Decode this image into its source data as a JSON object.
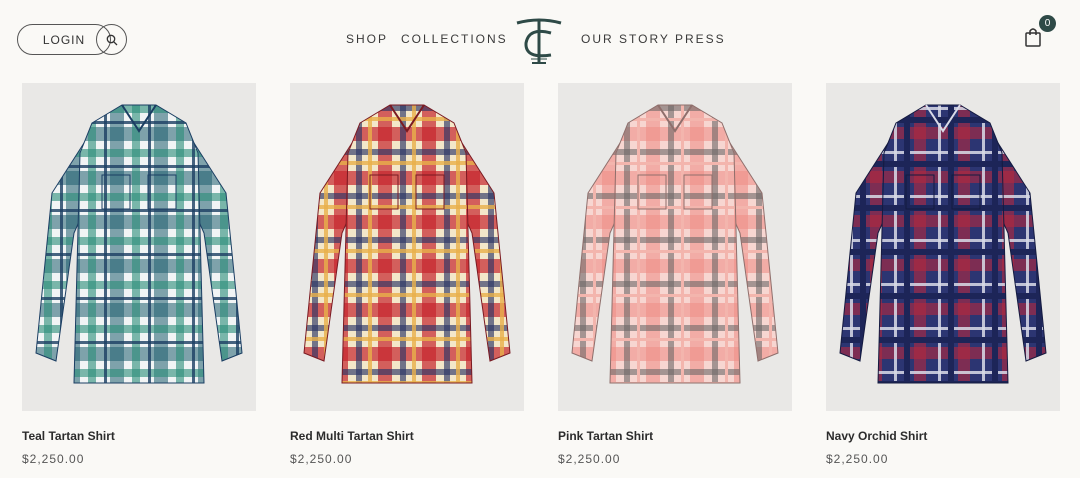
{
  "header": {
    "login_label": "LOGIN",
    "nav": {
      "shop": "SHOP",
      "collections": "COLLECTIONS",
      "our_story": "OUR STORY",
      "press": "PRESS"
    },
    "logo_text": "TC",
    "cart_count": "0",
    "icons": [
      "search-icon",
      "cart-icon"
    ],
    "accent_color": "#2e4a47"
  },
  "products": [
    {
      "name": "Teal Tartan Shirt",
      "price": "$2,250.00",
      "colors": {
        "base": "#f1f4f5",
        "a": "#1f5f6e",
        "b": "#2a8c78",
        "c": "#1b3e63"
      }
    },
    {
      "name": "Red Multi Tartan Shirt",
      "price": "$2,250.00",
      "colors": {
        "base": "#f3e7c9",
        "a": "#c7252d",
        "b": "#2b3566",
        "c": "#e9b04a"
      }
    },
    {
      "name": "Pink Tartan Shirt",
      "price": "$2,250.00",
      "colors": {
        "base": "#f7d6d1",
        "a": "#ef8f88",
        "b": "#6d6767",
        "c": "#f3b5ad"
      }
    },
    {
      "name": "Navy Orchid Shirt",
      "price": "$2,250.00",
      "colors": {
        "base": "#2c3572",
        "a": "#b3283e",
        "b": "#d9dbe8",
        "c": "#1d2558"
      }
    }
  ]
}
